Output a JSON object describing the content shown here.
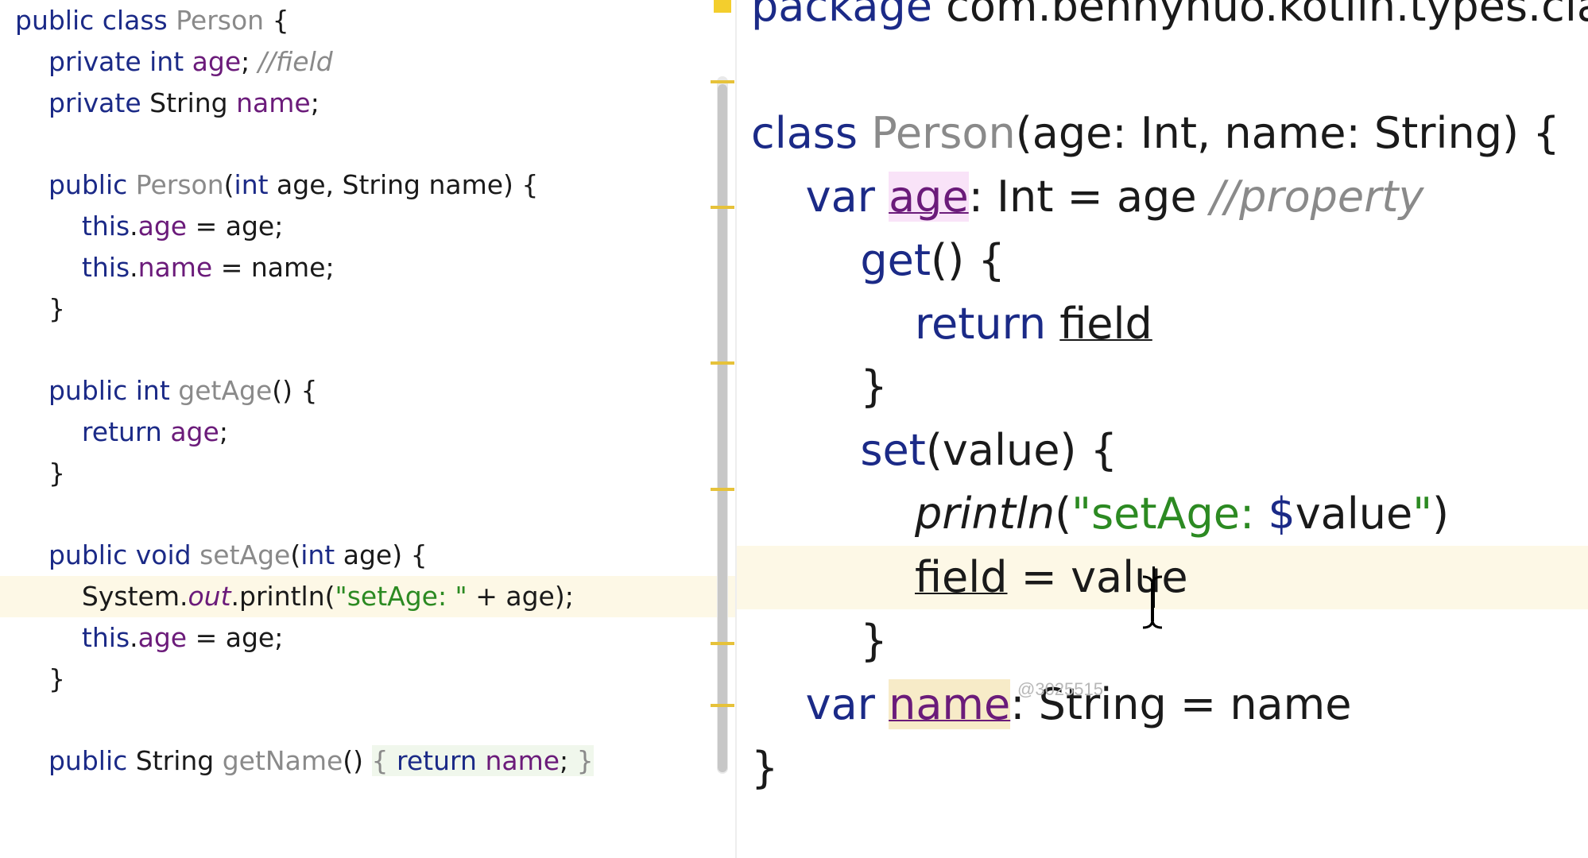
{
  "left_pane": {
    "lines": [
      {
        "segments": [
          {
            "t": "public class ",
            "c": "kw"
          },
          {
            "t": "Person",
            "c": "fn"
          },
          {
            "t": " {",
            "c": "plain"
          }
        ]
      },
      {
        "segments": [
          {
            "t": "    "
          },
          {
            "t": "private int ",
            "c": "kw"
          },
          {
            "t": "age",
            "c": "fld"
          },
          {
            "t": "; ",
            "c": "plain"
          },
          {
            "t": "//field",
            "c": "cmt"
          }
        ]
      },
      {
        "segments": [
          {
            "t": "    "
          },
          {
            "t": "private ",
            "c": "kw"
          },
          {
            "t": "String ",
            "c": "plain"
          },
          {
            "t": "name",
            "c": "fld"
          },
          {
            "t": ";",
            "c": "plain"
          }
        ]
      },
      {
        "segments": []
      },
      {
        "segments": [
          {
            "t": "    "
          },
          {
            "t": "public ",
            "c": "kw"
          },
          {
            "t": "Person",
            "c": "fn"
          },
          {
            "t": "(",
            "c": "plain"
          },
          {
            "t": "int ",
            "c": "kw"
          },
          {
            "t": "age, String name) {",
            "c": "plain"
          }
        ]
      },
      {
        "segments": [
          {
            "t": "        "
          },
          {
            "t": "this",
            "c": "kw"
          },
          {
            "t": ".",
            "c": "plain"
          },
          {
            "t": "age",
            "c": "fld"
          },
          {
            "t": " = age;",
            "c": "plain"
          }
        ]
      },
      {
        "segments": [
          {
            "t": "        "
          },
          {
            "t": "this",
            "c": "kw"
          },
          {
            "t": ".",
            "c": "plain"
          },
          {
            "t": "name",
            "c": "fld"
          },
          {
            "t": " = name;",
            "c": "plain"
          }
        ]
      },
      {
        "segments": [
          {
            "t": "    }",
            "c": "plain"
          }
        ]
      },
      {
        "segments": []
      },
      {
        "segments": [
          {
            "t": "    "
          },
          {
            "t": "public int ",
            "c": "kw"
          },
          {
            "t": "getAge",
            "c": "fn"
          },
          {
            "t": "() {",
            "c": "plain"
          }
        ]
      },
      {
        "segments": [
          {
            "t": "        "
          },
          {
            "t": "return ",
            "c": "kw"
          },
          {
            "t": "age",
            "c": "fld"
          },
          {
            "t": ";",
            "c": "plain"
          }
        ]
      },
      {
        "segments": [
          {
            "t": "    }",
            "c": "plain"
          }
        ]
      },
      {
        "segments": []
      },
      {
        "segments": [
          {
            "t": "    "
          },
          {
            "t": "public void ",
            "c": "kw"
          },
          {
            "t": "setAge",
            "c": "fn"
          },
          {
            "t": "(",
            "c": "plain"
          },
          {
            "t": "int ",
            "c": "kw"
          },
          {
            "t": "age) {",
            "c": "plain"
          }
        ]
      },
      {
        "segments": [
          {
            "t": "        "
          },
          {
            "t": "System.",
            "c": "plain"
          },
          {
            "t": "out",
            "c": "static"
          },
          {
            "t": ".println(",
            "c": "plain"
          },
          {
            "t": "\"setAge: \"",
            "c": "str"
          },
          {
            "t": " + age);",
            "c": "plain"
          }
        ],
        "highlight": true
      },
      {
        "segments": [
          {
            "t": "        "
          },
          {
            "t": "this",
            "c": "kw"
          },
          {
            "t": ".",
            "c": "plain"
          },
          {
            "t": "age",
            "c": "fld"
          },
          {
            "t": " = age;",
            "c": "plain"
          }
        ]
      },
      {
        "segments": [
          {
            "t": "    }",
            "c": "plain"
          }
        ]
      },
      {
        "segments": []
      },
      {
        "segments": [
          {
            "t": "    "
          },
          {
            "t": "public ",
            "c": "kw"
          },
          {
            "t": "String ",
            "c": "plain"
          },
          {
            "t": "getName",
            "c": "fn"
          },
          {
            "t": "() ",
            "c": "plain"
          },
          {
            "t": "{ ",
            "c": "fold-brace"
          },
          {
            "t": "return ",
            "c": "kw fold-body"
          },
          {
            "t": "name",
            "c": "fld fold-body"
          },
          {
            "t": "; ",
            "c": "plain fold-body"
          },
          {
            "t": "}",
            "c": "fold-brace"
          }
        ]
      }
    ]
  },
  "right_pane": {
    "lines": [
      {
        "segments": [
          {
            "t": "package ",
            "c": "kw"
          },
          {
            "t": "com.bennyhuo.kotlin.types.classes",
            "c": "plain"
          }
        ]
      },
      {
        "segments": []
      },
      {
        "segments": [
          {
            "t": "class ",
            "c": "kw"
          },
          {
            "t": "Person",
            "c": "fn"
          },
          {
            "t": "(age: Int, name: String) {",
            "c": "plain"
          }
        ]
      },
      {
        "segments": [
          {
            "t": "    "
          },
          {
            "t": "var ",
            "c": "kw"
          },
          {
            "t": "age",
            "c": "age-dec under"
          },
          {
            "t": ": Int = age ",
            "c": "plain"
          },
          {
            "t": "//property",
            "c": "cmt"
          }
        ]
      },
      {
        "segments": [
          {
            "t": "        "
          },
          {
            "t": "get",
            "c": "get-kw"
          },
          {
            "t": "() {",
            "c": "plain"
          }
        ]
      },
      {
        "segments": [
          {
            "t": "            "
          },
          {
            "t": "return ",
            "c": "kw"
          },
          {
            "t": "field",
            "c": "plain under"
          }
        ]
      },
      {
        "segments": [
          {
            "t": "        }",
            "c": "plain"
          }
        ]
      },
      {
        "segments": [
          {
            "t": "        "
          },
          {
            "t": "set",
            "c": "kw"
          },
          {
            "t": "(value) {",
            "c": "plain"
          }
        ]
      },
      {
        "segments": [
          {
            "t": "            "
          },
          {
            "t": "println",
            "c": "italic-fn"
          },
          {
            "t": "(",
            "c": "plain"
          },
          {
            "t": "\"setAge: ",
            "c": "str"
          },
          {
            "t": "$",
            "c": "kw"
          },
          {
            "t": "value",
            "c": "plain"
          },
          {
            "t": "\"",
            "c": "str"
          },
          {
            "t": ")",
            "c": "plain"
          }
        ]
      },
      {
        "segments": [
          {
            "t": "            "
          },
          {
            "t": "field",
            "c": "plain under"
          },
          {
            "t": " = value",
            "c": "plain"
          }
        ],
        "highlight": true
      },
      {
        "segments": [
          {
            "t": "        }",
            "c": "plain"
          }
        ]
      },
      {
        "segments": [
          {
            "t": "    "
          },
          {
            "t": "var ",
            "c": "kw"
          },
          {
            "t": "name",
            "c": "name-hl under"
          },
          {
            "t": ": String = name",
            "c": "plain"
          }
        ]
      },
      {
        "segments": [
          {
            "t": "}",
            "c": "plain"
          }
        ]
      }
    ]
  },
  "watermark": "@3025515",
  "icons": {
    "ibeam": "text-cursor-ibeam-icon"
  },
  "colors": {
    "keyword": "#1b2a87",
    "field": "#6b1b7a",
    "string": "#2c8a22",
    "comment": "#8a8a8a",
    "line_highlight": "#fdf8e6"
  }
}
